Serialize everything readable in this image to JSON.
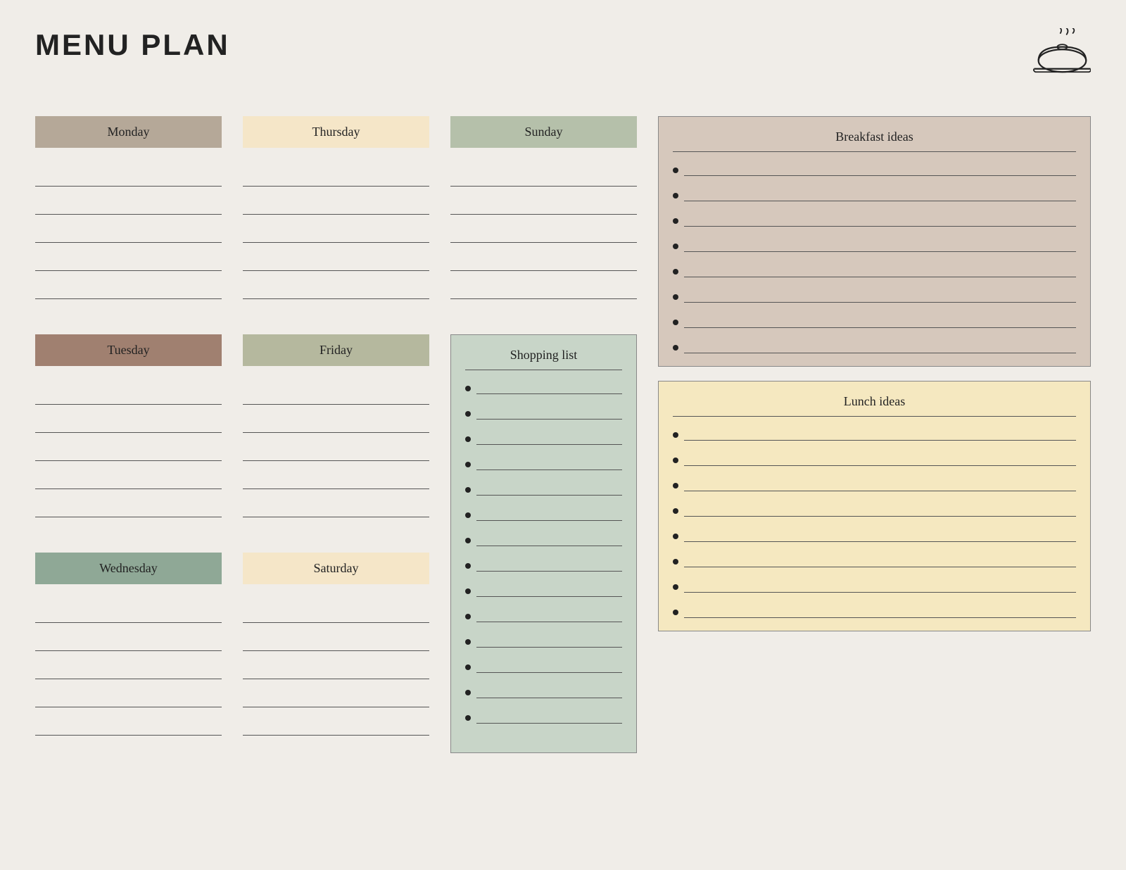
{
  "header": {
    "title": "MENU PLAN"
  },
  "days": [
    {
      "id": "monday",
      "label": "Monday",
      "color": "monday",
      "lines": 5
    },
    {
      "id": "tuesday",
      "label": "Tuesday",
      "color": "tuesday",
      "lines": 5
    },
    {
      "id": "wednesday",
      "label": "Wednesday",
      "color": "wednesday",
      "lines": 5
    },
    {
      "id": "thursday",
      "label": "Thursday",
      "color": "thursday",
      "lines": 5
    },
    {
      "id": "friday",
      "label": "Friday",
      "color": "friday",
      "lines": 5
    },
    {
      "id": "saturday",
      "label": "Saturday",
      "color": "saturday",
      "lines": 5
    }
  ],
  "sunday": {
    "label": "Sunday",
    "color": "sunday",
    "lines": 5
  },
  "shopping_list": {
    "title": "Shopping list",
    "items": 14
  },
  "breakfast_ideas": {
    "title": "Breakfast ideas",
    "items": 8
  },
  "lunch_ideas": {
    "title": "Lunch ideas",
    "items": 8
  }
}
